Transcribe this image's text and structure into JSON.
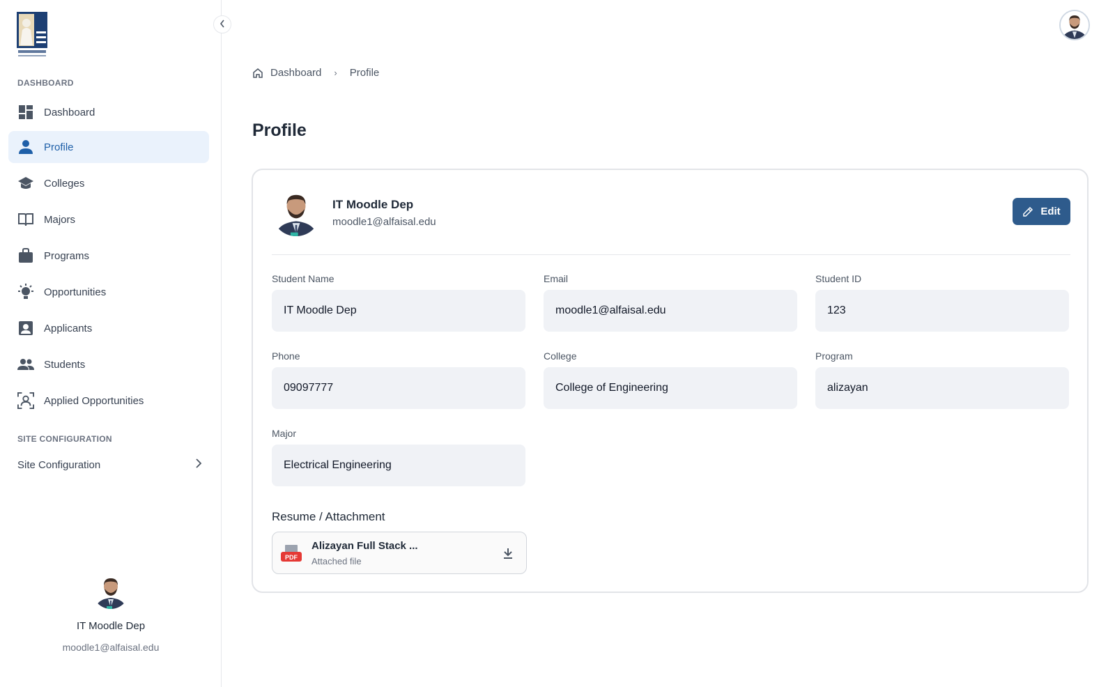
{
  "sidebar": {
    "sections": {
      "dashboard": "DASHBOARD",
      "site_configuration": "SITE CONFIGURATION"
    },
    "items": [
      {
        "label": "Dashboard",
        "icon": "dashboard-icon"
      },
      {
        "label": "Profile",
        "icon": "person-icon",
        "active": true
      },
      {
        "label": "Colleges",
        "icon": "graduation-cap-icon"
      },
      {
        "label": "Majors",
        "icon": "book-icon"
      },
      {
        "label": "Programs",
        "icon": "briefcase-icon"
      },
      {
        "label": "Opportunities",
        "icon": "lightbulb-icon"
      },
      {
        "label": "Applicants",
        "icon": "contact-card-icon"
      },
      {
        "label": "Students",
        "icon": "group-icon"
      },
      {
        "label": "Applied Opportunities",
        "icon": "face-scan-icon"
      }
    ],
    "site_config_label": "Site Configuration",
    "user": {
      "name": "IT Moodle Dep",
      "email": "moodle1@alfaisal.edu"
    }
  },
  "breadcrumb": {
    "home": "Dashboard",
    "current": "Profile"
  },
  "page": {
    "title": "Profile"
  },
  "profile": {
    "name": "IT Moodle Dep",
    "email": "moodle1@alfaisal.edu",
    "edit_label": "Edit",
    "fields": {
      "student_name": {
        "label": "Student Name",
        "value": "IT Moodle Dep"
      },
      "email": {
        "label": "Email",
        "value": "moodle1@alfaisal.edu"
      },
      "student_id": {
        "label": "Student ID",
        "value": "123"
      },
      "phone": {
        "label": "Phone",
        "value": "09097777"
      },
      "college": {
        "label": "College",
        "value": "College of Engineering"
      },
      "program": {
        "label": "Program",
        "value": "alizayan"
      },
      "major": {
        "label": "Major",
        "value": "Electrical Engineering"
      }
    },
    "resume": {
      "title": "Resume / Attachment",
      "file_name": "Alizayan Full Stack ...",
      "file_sub": "Attached file",
      "file_badge": "PDF"
    }
  },
  "colors": {
    "accent": "#1e5fa8",
    "active_bg": "#eaf2fc",
    "edit_button": "#2e5b8c",
    "field_bg": "#f0f2f6"
  }
}
